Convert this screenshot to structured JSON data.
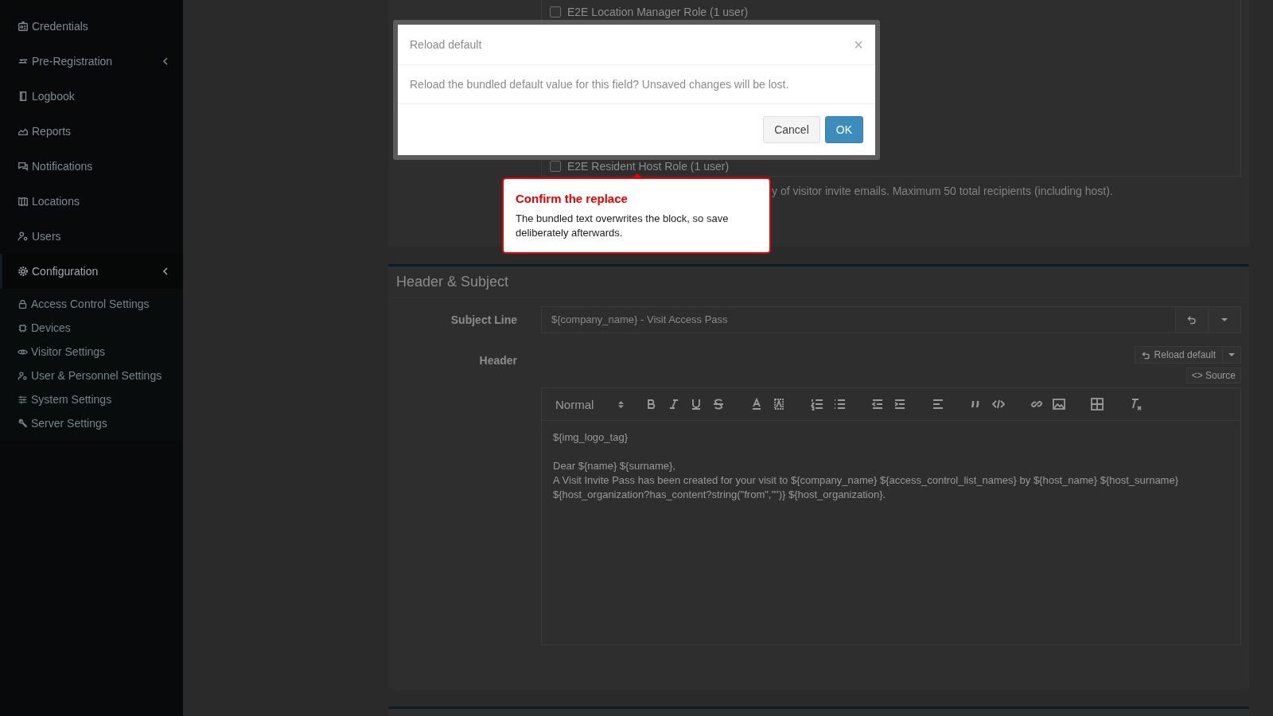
{
  "sidebar": {
    "items": [
      {
        "label": "Credentials",
        "selected": false,
        "has_submenu": false
      },
      {
        "label": "Pre-Registration",
        "selected": false,
        "has_submenu": true
      },
      {
        "label": "Logbook",
        "selected": false,
        "has_submenu": false
      },
      {
        "label": "Reports",
        "selected": false,
        "has_submenu": false
      },
      {
        "label": "Notifications",
        "selected": false,
        "has_submenu": false
      },
      {
        "label": "Locations",
        "selected": false,
        "has_submenu": false
      },
      {
        "label": "Users",
        "selected": false,
        "has_submenu": false
      },
      {
        "label": "Configuration",
        "selected": true,
        "has_submenu": true,
        "children": [
          {
            "label": "Access Control Settings"
          },
          {
            "label": "Devices"
          },
          {
            "label": "Visitor Settings"
          },
          {
            "label": "User & Personnel Settings"
          },
          {
            "label": "System Settings"
          },
          {
            "label": "Server Settings"
          }
        ]
      }
    ]
  },
  "roles": [
    {
      "label": "E2E Location Manager Role (1 user)",
      "checked": false
    },
    {
      "label": "E2E Resident Host Role (1 user)",
      "checked": false
    }
  ],
  "roles_help": "y of visitor invite emails. Maximum 50 total recipients (including host).",
  "header_subject": {
    "title": "Header & Subject",
    "subject_label": "Subject Line",
    "subject_value": "${company_name} - Visit Access Pass",
    "header_label": "Header",
    "reload_button": "Reload default",
    "source_button": "<> Source",
    "format_select": "Normal",
    "editor_paragraphs": [
      {
        "lines": [
          "${img_logo_tag}"
        ]
      },
      {
        "lines": [
          "Dear ${name} ${surname},",
          "A Visit Invite Pass has been created for your visit to ${company_name} ${access_control_list_names} by ${host_name} ${host_surname} ${host_organization?has_content?string(\"from\",\"\")} ${host_organization}."
        ]
      }
    ]
  },
  "modal": {
    "title": "Reload default",
    "close": "×",
    "message": "Reload the bundled default value for this field? Unsaved changes will be lost.",
    "buttons": [
      {
        "label": "Cancel",
        "kind": "default"
      },
      {
        "label": "OK",
        "kind": "primary"
      }
    ]
  },
  "callout": {
    "title": "Confirm the replace",
    "text": "The bundled text overwrites the block, so save deliberately afterwards."
  }
}
